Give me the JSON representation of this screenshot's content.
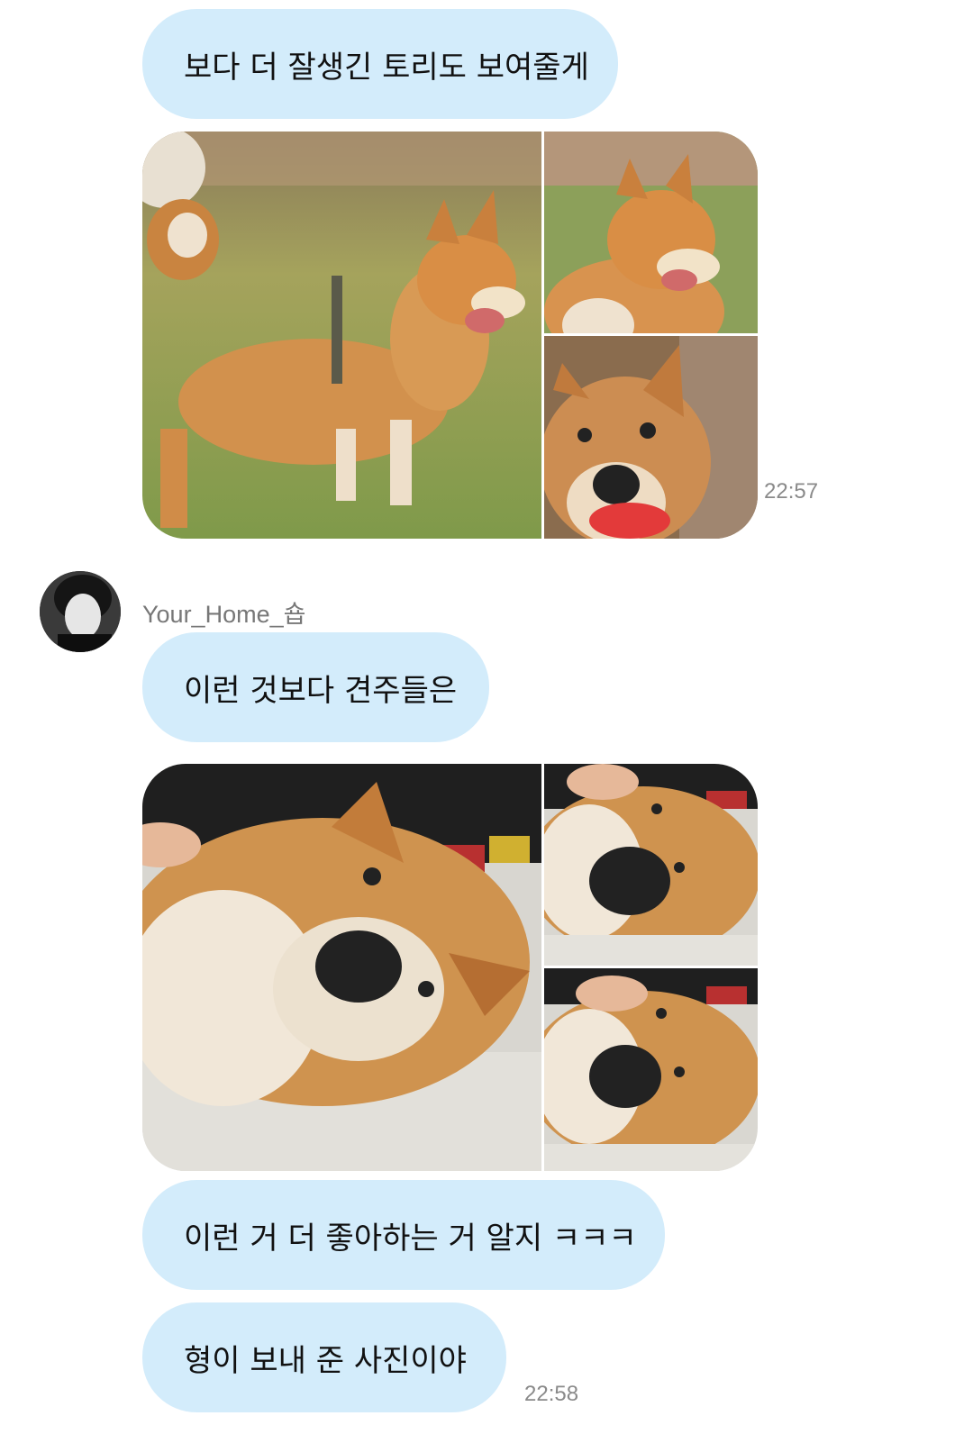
{
  "messages": {
    "msg1": "보다 더 잘생긴 토리도 보여줄게",
    "time1": "22:57",
    "sender": "Your_Home_숍",
    "msg2": "이런 것보다 견주들은",
    "msg3": "이런 거 더 좋아하는 거 알지 ㅋㅋㅋ",
    "msg4": "형이 보내 준 사진이야",
    "time2": "22:58"
  },
  "photos": {
    "gallery1": [
      "shiba-standing-grass-photo",
      "shiba-smiling-closeup-photo",
      "shiba-red-ball-photo"
    ],
    "gallery2": [
      "shiba-lying-large-photo",
      "shiba-petted-photo-top",
      "shiba-petted-photo-bottom"
    ]
  },
  "colors": {
    "bubble": "#d3ecfb",
    "timestamp": "#8a8a8a",
    "sender": "#777777"
  }
}
